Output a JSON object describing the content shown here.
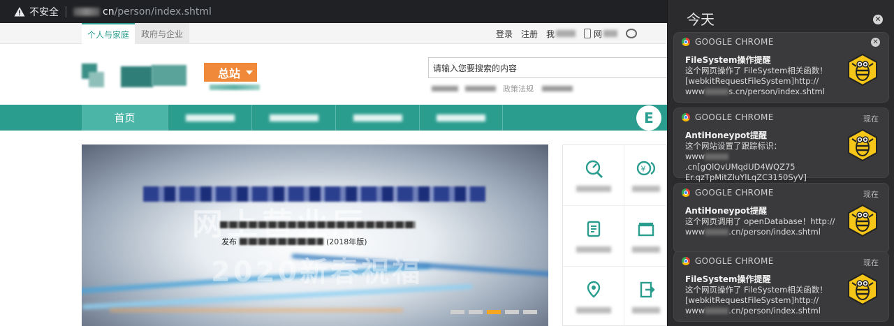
{
  "browser": {
    "security_label": "不安全",
    "url_domain_suffix": "cn",
    "url_path": "/person/index.shtml"
  },
  "site": {
    "top_tabs": [
      "个人与家庭",
      "政府与企业"
    ],
    "top_links": [
      "登录",
      "注册",
      "我"
    ],
    "top_links_extra": "网",
    "branch_button": "总站",
    "search_placeholder": "请输入您要搜索的内容",
    "hotword_visible": "政策法规",
    "nav_home": "首页",
    "banner_year_text": "2020新春祝福",
    "banner_line2_prefix": "发布",
    "banner_line2_suffix": "(2018年版)",
    "banner_ghost_text": "网上营业厅"
  },
  "notification_center": {
    "title": "今天",
    "clear_icon": "close-icon",
    "notifications": [
      {
        "app": "GOOGLE CHROME",
        "time": "",
        "title": "FileSystem操作提醒",
        "line1": "这个网页操作了 FileSystem相关函数！",
        "line2": "[webkitRequestFileSystem]http://",
        "line3_prefix": "www",
        "line3_suffix": "s.cn/person/index.shtml",
        "icon": "antihoneypot-bee-icon"
      },
      {
        "app": "GOOGLE CHROME",
        "time": "现在",
        "title": "AntiHoneypot提醒",
        "line1": "这个网站设置了跟踪标识：",
        "line2_prefix": "www",
        "line2_suffix": ".cn[gQlQvUMqdUD4WQZ75",
        "line3": "Er.qzTpMitZluYlLqZC3150SyV]",
        "icon": "antihoneypot-bee-icon"
      },
      {
        "app": "GOOGLE CHROME",
        "time": "现在",
        "title": "AntiHoneypot提醒",
        "line1": "这个网页调用了 openDatabase！http://",
        "line2_prefix": "www",
        "line2_suffix": ".cn/person/index.shtml",
        "icon": "antihoneypot-bee-icon"
      },
      {
        "app": "GOOGLE CHROME",
        "time": "现在",
        "title": "FileSystem操作提醒",
        "line1": "这个网页操作了 FileSystem相关函数！",
        "line2": "[webkitRequestFileSystem]http://",
        "line3_prefix": "www",
        "line3_suffix": ".cn/person/index.shtml",
        "icon": "antihoneypot-bee-icon"
      }
    ]
  },
  "colors": {
    "brand_green": "#2a9d8f",
    "nav_home_bg": "#4bb5a8",
    "branch_orange": "#f08a3a",
    "banner_active_dot": "#f5a623",
    "nc_bg": "#2b2b2d",
    "card_bg": "#3a3a3c",
    "bee_yellow": "#f5c518"
  }
}
